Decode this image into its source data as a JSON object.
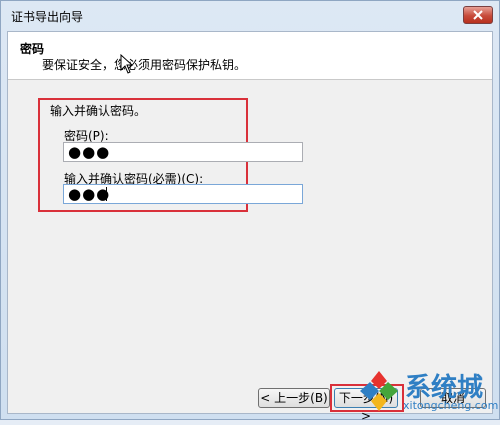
{
  "window": {
    "title": "证书导出向导"
  },
  "header": {
    "title": "密码",
    "subtitle": "要保证安全，您必须用密码保护私钥。"
  },
  "form": {
    "group_label": "输入并确认密码。",
    "password_label": "密码(P):",
    "password_value": "●●●",
    "confirm_label": "输入并确认密码(必需)(C):",
    "confirm_value": "●●●"
  },
  "buttons": {
    "back": "< 上一步(B)",
    "next": "下一步(N) >",
    "cancel": "取消"
  },
  "watermark": {
    "name": "系统城",
    "url": "xitongcheng.com"
  },
  "colors": {
    "highlight": "#d9303a",
    "brand": "#2f7fc4"
  },
  "icons": {
    "close": "close-icon",
    "cursor": "mouse-pointer-icon",
    "logo": "windows-logo-icon"
  }
}
